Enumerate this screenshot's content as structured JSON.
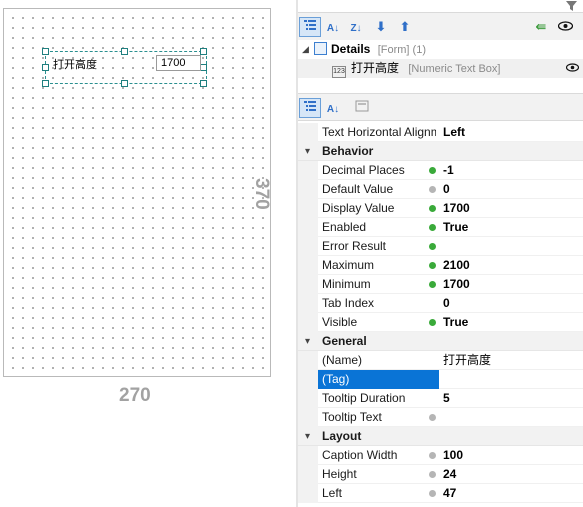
{
  "canvas": {
    "caption": "打开高度",
    "numeric_value": "1700",
    "width_label": "270",
    "height_label": "370"
  },
  "tree": {
    "form_name": "Details",
    "form_type": "[Form] (1)",
    "control_name": "打开高度",
    "control_type": "[Numeric Text Box]"
  },
  "properties": [
    {
      "kind": "prop",
      "name": "Text Horizontal Alignment",
      "dot": "none",
      "value": "Left"
    },
    {
      "kind": "cat",
      "name": "Behavior"
    },
    {
      "kind": "prop",
      "name": "Decimal Places",
      "dot": "green",
      "value": "-1"
    },
    {
      "kind": "prop",
      "name": "Default Value",
      "dot": "gray",
      "value": "0"
    },
    {
      "kind": "prop",
      "name": "Display Value",
      "dot": "green",
      "value": "1700"
    },
    {
      "kind": "prop",
      "name": "Enabled",
      "dot": "green",
      "value": "True"
    },
    {
      "kind": "prop",
      "name": "Error Result",
      "dot": "green",
      "value": ""
    },
    {
      "kind": "prop",
      "name": "Maximum",
      "dot": "green",
      "value": "2100"
    },
    {
      "kind": "prop",
      "name": "Minimum",
      "dot": "green",
      "value": "1700"
    },
    {
      "kind": "prop",
      "name": "Tab Index",
      "dot": "none",
      "value": "0"
    },
    {
      "kind": "prop",
      "name": "Visible",
      "dot": "green",
      "value": "True"
    },
    {
      "kind": "cat",
      "name": "General"
    },
    {
      "kind": "prop",
      "name": "(Name)",
      "dot": "none",
      "value": "打开高度",
      "normal": true
    },
    {
      "kind": "prop",
      "name": "(Tag)",
      "dot": "none",
      "value": "",
      "selected": true
    },
    {
      "kind": "prop",
      "name": "Tooltip Duration",
      "dot": "none",
      "value": "5"
    },
    {
      "kind": "prop",
      "name": "Tooltip Text",
      "dot": "gray",
      "value": ""
    },
    {
      "kind": "cat",
      "name": "Layout"
    },
    {
      "kind": "prop",
      "name": "Caption Width",
      "dot": "gray",
      "value": "100"
    },
    {
      "kind": "prop",
      "name": "Height",
      "dot": "gray",
      "value": "24"
    },
    {
      "kind": "prop",
      "name": "Left",
      "dot": "gray",
      "value": "47"
    }
  ]
}
